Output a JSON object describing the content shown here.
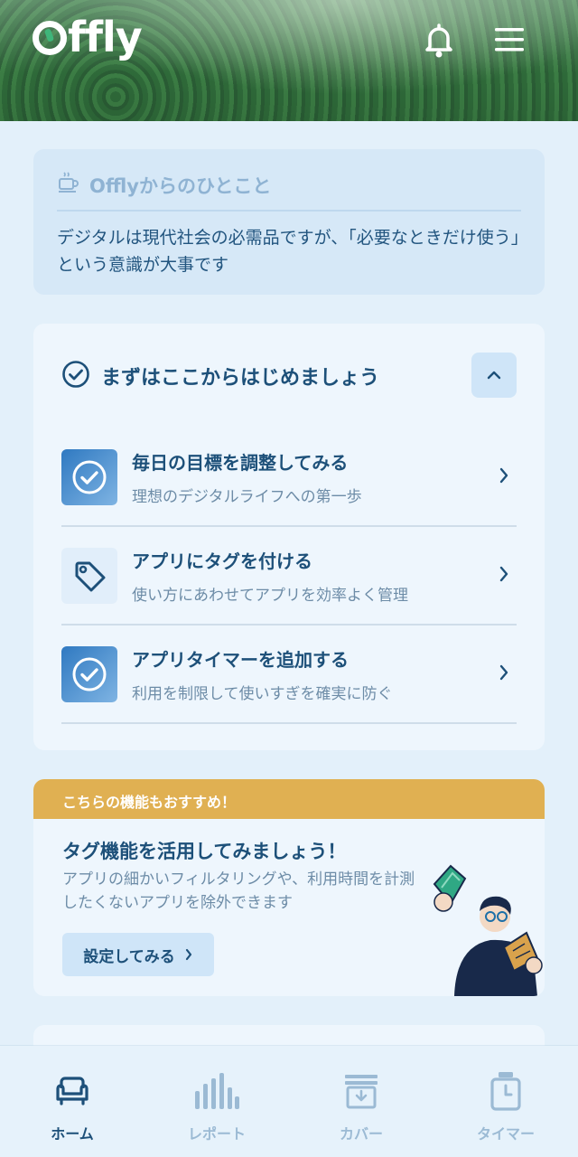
{
  "app": {
    "name": "Offly",
    "logo_rest": "ffly"
  },
  "header": {
    "bell_icon": "bell-icon",
    "menu_icon": "hamburger-menu-icon"
  },
  "quote": {
    "icon": "coffee-cup-icon",
    "title": "Offlyからのひとこと",
    "text": "デジタルは現代社会の必需品ですが、「必要なときだけ使う」という意識が大事です"
  },
  "getting_started": {
    "title": "まずはここからはじめましょう",
    "steps": [
      {
        "title": "毎日の目標を調整してみる",
        "subtitle": "理想のデジタルライフへの第一歩",
        "icon": "check-circle-icon"
      },
      {
        "title": "アプリにタグを付ける",
        "subtitle": "使い方にあわせてアプリを効率よく管理",
        "icon": "tag-icon"
      },
      {
        "title": "アプリタイマーを追加する",
        "subtitle": "利用を制限して使いすぎを確実に防ぐ",
        "icon": "check-circle-icon"
      }
    ]
  },
  "promo": {
    "banner": "こちらの機能もおすすめ！",
    "title": "タグ機能を活用してみましょう！",
    "description": "アプリの細かいフィルタリングや、利用時間を計測したくないアプリを除外できます",
    "button": "設定してみる"
  },
  "nav": [
    {
      "label": "ホーム",
      "icon": "sofa-icon",
      "active": true
    },
    {
      "label": "レポート",
      "icon": "bar-chart-icon",
      "active": false
    },
    {
      "label": "カバー",
      "icon": "cover-tray-icon",
      "active": false
    },
    {
      "label": "タイマー",
      "icon": "timer-icon",
      "active": false
    }
  ],
  "colors": {
    "accent": "#1d5079",
    "banner": "#e0b052",
    "background": "#e3f0fa"
  }
}
